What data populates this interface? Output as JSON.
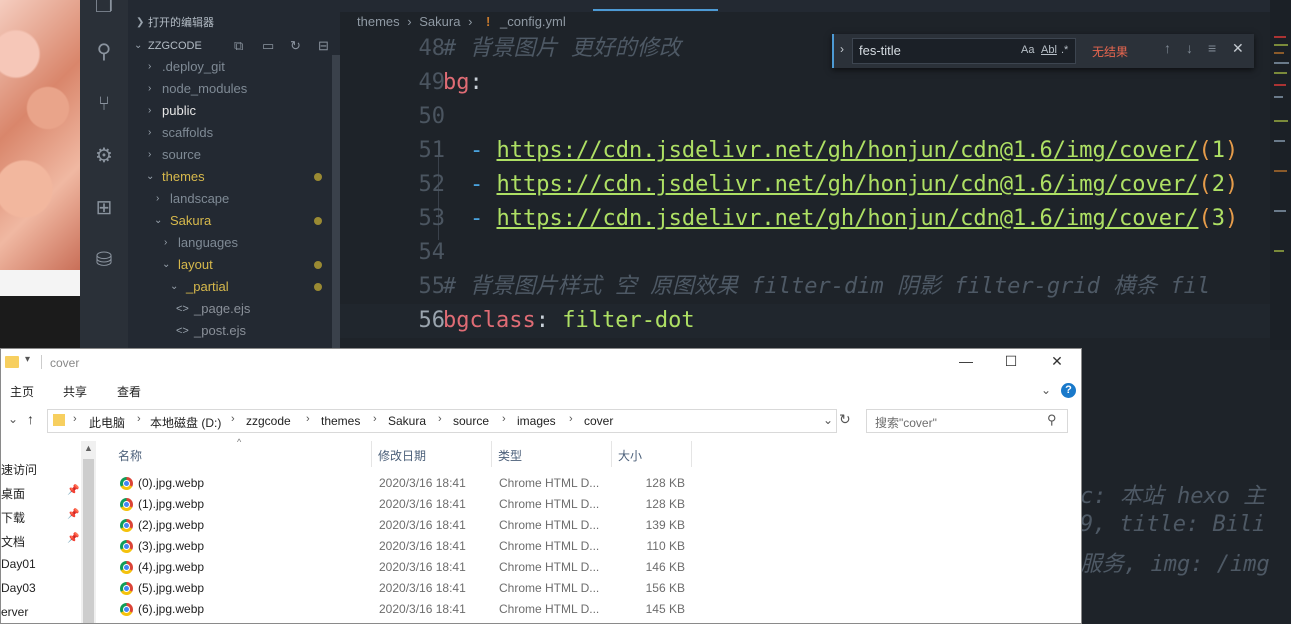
{
  "sidebar": {
    "open_editors": "打开的编辑器",
    "workspace": "ZZGCODE",
    "items": [
      {
        "label": ".deploy_git"
      },
      {
        "label": "node_modules"
      },
      {
        "label": "public"
      },
      {
        "label": "scaffolds"
      },
      {
        "label": "source"
      },
      {
        "label": "themes"
      },
      {
        "label": "landscape"
      },
      {
        "label": "Sakura"
      },
      {
        "label": "languages"
      },
      {
        "label": "layout"
      },
      {
        "label": "_partial"
      },
      {
        "label": "_page.ejs"
      },
      {
        "label": "_post.ejs"
      }
    ]
  },
  "editor": {
    "breadcrumb": [
      "themes",
      "Sakura",
      "_config.yml"
    ],
    "lines": [
      {
        "n": "48",
        "comment": "# 背景图片 更好的修改"
      },
      {
        "n": "49",
        "key": "bg",
        "punc": ":"
      },
      {
        "n": "50"
      },
      {
        "n": "51",
        "url": "https://cdn.jsdelivr.net/gh/honjun/cdn@1.6/img/cover/",
        "num": "1"
      },
      {
        "n": "52",
        "url": "https://cdn.jsdelivr.net/gh/honjun/cdn@1.6/img/cover/",
        "num": "2"
      },
      {
        "n": "53",
        "url": "https://cdn.jsdelivr.net/gh/honjun/cdn@1.6/img/cover/",
        "num": "3"
      },
      {
        "n": "54"
      },
      {
        "n": "55",
        "comment": "# 背景图片样式 空 原图效果 filter-dim 阴影 filter-grid 横条 fil"
      },
      {
        "n": "56",
        "key": "bgclass",
        "punc": ":",
        "value": "filter-dot"
      }
    ],
    "bg_lines": [
      "c: 本站 hexo 主",
      "9, title: Bili",
      "服务, img: /img"
    ]
  },
  "find": {
    "query": "fes-title",
    "opt_case": "Aa",
    "opt_word": "Abl",
    "opt_regex": ".*",
    "result": "无结果"
  },
  "explorer": {
    "title": "cover",
    "ribbon": [
      "主页",
      "共享",
      "查看"
    ],
    "path": [
      "此电脑",
      "本地磁盘 (D:)",
      "zzgcode",
      "themes",
      "Sakura",
      "source",
      "images",
      "cover"
    ],
    "search_placeholder": "搜索\"cover\"",
    "nav": [
      "速访问",
      "桌面",
      "下载",
      "文档",
      "Day01",
      "Day03",
      "erver"
    ],
    "columns": {
      "name": "名称",
      "date": "修改日期",
      "type": "类型",
      "size": "大小"
    },
    "files": [
      {
        "name": "(0).jpg.webp",
        "date": "2020/3/16 18:41",
        "type": "Chrome HTML D...",
        "size": "128 KB"
      },
      {
        "name": "(1).jpg.webp",
        "date": "2020/3/16 18:41",
        "type": "Chrome HTML D...",
        "size": "128 KB"
      },
      {
        "name": "(2).jpg.webp",
        "date": "2020/3/16 18:41",
        "type": "Chrome HTML D...",
        "size": "139 KB"
      },
      {
        "name": "(3).jpg.webp",
        "date": "2020/3/16 18:41",
        "type": "Chrome HTML D...",
        "size": "110 KB"
      },
      {
        "name": "(4).jpg.webp",
        "date": "2020/3/16 18:41",
        "type": "Chrome HTML D...",
        "size": "146 KB"
      },
      {
        "name": "(5).jpg.webp",
        "date": "2020/3/16 18:41",
        "type": "Chrome HTML D...",
        "size": "156 KB"
      },
      {
        "name": "(6).jpg.webp",
        "date": "2020/3/16 18:41",
        "type": "Chrome HTML D...",
        "size": "145 KB"
      }
    ]
  }
}
